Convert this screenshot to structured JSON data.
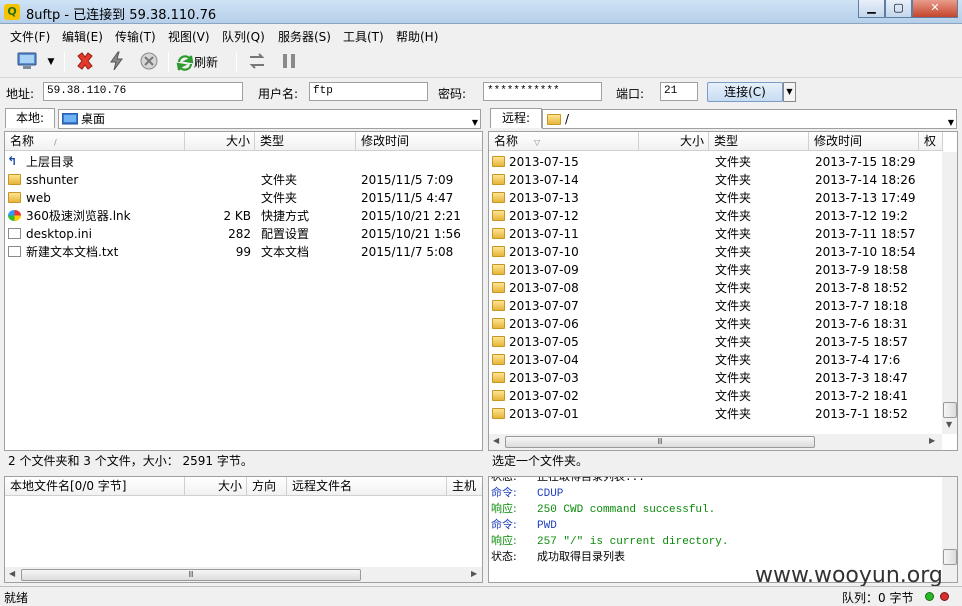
{
  "window": {
    "title": "8uftp - 已连接到 59.38.110.76",
    "icon_label": "Q"
  },
  "menu": [
    "文件(F)",
    "编辑(E)",
    "传输(T)",
    "视图(V)",
    "队列(Q)",
    "服务器(S)",
    "工具(T)",
    "帮助(H)"
  ],
  "toolbar": {
    "refresh_label": "刷新"
  },
  "connection": {
    "addr_label": "地址:",
    "addr_value": "59.38.110.76",
    "user_label": "用户名:",
    "user_value": "ftp",
    "pass_label": "密码:",
    "pass_value": "***********",
    "port_label": "端口:",
    "port_value": "21",
    "connect_label": "连接(C)"
  },
  "local": {
    "tab": "本地:",
    "path": "桌面",
    "columns": [
      "名称",
      "大小",
      "类型",
      "修改时间"
    ],
    "files": [
      {
        "name": "上层目录",
        "size": "",
        "type": "",
        "mtime": "",
        "icon": "up-icon"
      },
      {
        "name": "sshunter",
        "size": "",
        "type": "文件夹",
        "mtime": "2015/11/5 7:09",
        "icon": "folder-icon"
      },
      {
        "name": "web",
        "size": "",
        "type": "文件夹",
        "mtime": "2015/11/5 4:47",
        "icon": "folder-icon"
      },
      {
        "name": "360极速浏览器.lnk",
        "size": "2 KB",
        "type": "快捷方式",
        "mtime": "2015/10/21 2:21",
        "icon": "browser-icon"
      },
      {
        "name": "desktop.ini",
        "size": "282",
        "type": "配置设置",
        "mtime": "2015/10/21 1:56",
        "icon": "ini-file-icon"
      },
      {
        "name": "新建文本文档.txt",
        "size": "99",
        "type": "文本文档",
        "mtime": "2015/11/7 5:08",
        "icon": "text-file-icon"
      }
    ],
    "status": "2 个文件夹和 3 个文件，大小： 2591 字节。"
  },
  "remote": {
    "tab": "远程:",
    "path": "/",
    "columns": [
      "名称",
      "大小",
      "类型",
      "修改时间",
      "权"
    ],
    "files": [
      {
        "name": "2013-07-15",
        "type": "文件夹",
        "mtime": "2013-7-15 18:29"
      },
      {
        "name": "2013-07-14",
        "type": "文件夹",
        "mtime": "2013-7-14 18:26"
      },
      {
        "name": "2013-07-13",
        "type": "文件夹",
        "mtime": "2013-7-13 17:49"
      },
      {
        "name": "2013-07-12",
        "type": "文件夹",
        "mtime": "2013-7-12 19:2"
      },
      {
        "name": "2013-07-11",
        "type": "文件夹",
        "mtime": "2013-7-11 18:57"
      },
      {
        "name": "2013-07-10",
        "type": "文件夹",
        "mtime": "2013-7-10 18:54"
      },
      {
        "name": "2013-07-09",
        "type": "文件夹",
        "mtime": "2013-7-9 18:58"
      },
      {
        "name": "2013-07-08",
        "type": "文件夹",
        "mtime": "2013-7-8 18:52"
      },
      {
        "name": "2013-07-07",
        "type": "文件夹",
        "mtime": "2013-7-7 18:18"
      },
      {
        "name": "2013-07-06",
        "type": "文件夹",
        "mtime": "2013-7-6 18:31"
      },
      {
        "name": "2013-07-05",
        "type": "文件夹",
        "mtime": "2013-7-5 18:57"
      },
      {
        "name": "2013-07-04",
        "type": "文件夹",
        "mtime": "2013-7-4 17:6"
      },
      {
        "name": "2013-07-03",
        "type": "文件夹",
        "mtime": "2013-7-3 18:47"
      },
      {
        "name": "2013-07-02",
        "type": "文件夹",
        "mtime": "2013-7-2 18:41"
      },
      {
        "name": "2013-07-01",
        "type": "文件夹",
        "mtime": "2013-7-1 18:52"
      }
    ],
    "status": "选定一个文件夹。"
  },
  "queue": {
    "columns": [
      "本地文件名[0/0 字节]",
      "大小",
      "方向",
      "远程文件名",
      "主机"
    ]
  },
  "log": [
    {
      "kind": "状态:",
      "text": "正在取得目录列表...",
      "color": "#000000"
    },
    {
      "kind": "命令:",
      "text": "CDUP",
      "color": "#1f3fb8"
    },
    {
      "kind": "响应:",
      "text": "250 CWD command successful.",
      "color": "#0a8a0a"
    },
    {
      "kind": "命令:",
      "text": "PWD",
      "color": "#1f3fb8"
    },
    {
      "kind": "响应:",
      "text": "257 \"/\" is current directory.",
      "color": "#0a8a0a"
    },
    {
      "kind": "状态:",
      "text": "成功取得目录列表",
      "color": "#000000"
    }
  ],
  "statusbar": {
    "left": "就绪",
    "queue": "队列：0 字节"
  },
  "watermark": "www.wooyun.org"
}
